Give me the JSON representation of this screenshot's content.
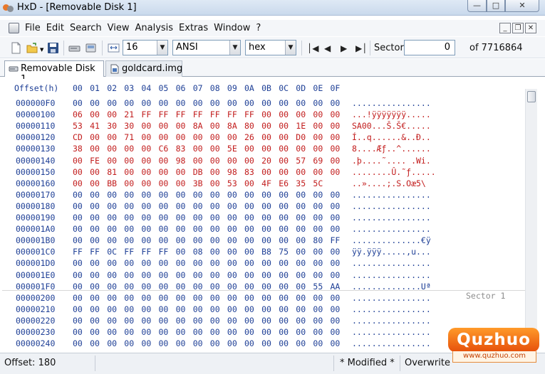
{
  "window": {
    "title": "HxD - [Removable Disk 1]"
  },
  "menu": {
    "items": [
      "File",
      "Edit",
      "Search",
      "View",
      "Analysis",
      "Extras",
      "Window",
      "?"
    ]
  },
  "toolbar": {
    "bytes_per_row": "16",
    "charset": "ANSI",
    "offset_base": "hex",
    "sector_label": "Sector",
    "sector_value": "0",
    "sector_total": "of 7716864"
  },
  "tabs": [
    {
      "label": "Removable Disk 1",
      "active": true
    },
    {
      "label": "goldcard.img",
      "active": false
    }
  ],
  "hex": {
    "header_offset": "Offset(h)",
    "header_cols": [
      "00",
      "01",
      "02",
      "03",
      "04",
      "05",
      "06",
      "07",
      "08",
      "09",
      "0A",
      "0B",
      "0C",
      "0D",
      "0E",
      "0F"
    ],
    "sector_marker": "Sector 1",
    "rows": [
      {
        "offset": "000000F0",
        "bytes": [
          "00",
          "00",
          "00",
          "00",
          "00",
          "00",
          "00",
          "00",
          "00",
          "00",
          "00",
          "00",
          "00",
          "00",
          "00",
          "00"
        ],
        "ascii": "................"
      },
      {
        "offset": "00000100",
        "bytes": [
          "06",
          "00",
          "00",
          "21",
          "FF",
          "FF",
          "FF",
          "FF",
          "FF",
          "FF",
          "FF",
          "00",
          "00",
          "00",
          "00",
          "00"
        ],
        "ascii": "...!ÿÿÿÿÿÿÿ....."
      },
      {
        "offset": "00000110",
        "bytes": [
          "53",
          "41",
          "30",
          "30",
          "00",
          "00",
          "00",
          "8A",
          "00",
          "8A",
          "80",
          "00",
          "00",
          "1E",
          "00",
          "00"
        ],
        "ascii": "SA00...Š.Š€....."
      },
      {
        "offset": "00000120",
        "bytes": [
          "CD",
          "00",
          "00",
          "71",
          "00",
          "00",
          "00",
          "00",
          "00",
          "00",
          "26",
          "00",
          "00",
          "D0",
          "00",
          "00"
        ],
        "ascii": "Í..q......&..Ð.."
      },
      {
        "offset": "00000130",
        "bytes": [
          "38",
          "00",
          "00",
          "00",
          "00",
          "C6",
          "83",
          "00",
          "00",
          "5E",
          "00",
          "00",
          "00",
          "00",
          "00",
          "00"
        ],
        "ascii": "8....Æƒ..^......"
      },
      {
        "offset": "00000140",
        "bytes": [
          "00",
          "FE",
          "00",
          "00",
          "00",
          "00",
          "98",
          "00",
          "00",
          "00",
          "00",
          "20",
          "00",
          "57",
          "69",
          "00"
        ],
        "ascii": ".þ....˜.... .Wi."
      },
      {
        "offset": "00000150",
        "bytes": [
          "00",
          "00",
          "81",
          "00",
          "00",
          "00",
          "00",
          "DB",
          "00",
          "98",
          "83",
          "00",
          "00",
          "00",
          "00",
          "00"
        ],
        "ascii": "........Û.˜ƒ....."
      },
      {
        "offset": "00000160",
        "bytes": [
          "00",
          "00",
          "BB",
          "00",
          "00",
          "00",
          "00",
          "3B",
          "00",
          "53",
          "00",
          "4F",
          "E6",
          "35",
          "5C",
          ""
        ],
        "ascii": "..»....;.S.Oæ5\\"
      },
      {
        "offset": "00000170",
        "bytes": [
          "00",
          "00",
          "00",
          "00",
          "00",
          "00",
          "00",
          "00",
          "00",
          "00",
          "00",
          "00",
          "00",
          "00",
          "00",
          "00"
        ],
        "ascii": "................"
      },
      {
        "offset": "00000180",
        "bytes": [
          "00",
          "00",
          "00",
          "00",
          "00",
          "00",
          "00",
          "00",
          "00",
          "00",
          "00",
          "00",
          "00",
          "00",
          "00",
          "00"
        ],
        "ascii": "................"
      },
      {
        "offset": "00000190",
        "bytes": [
          "00",
          "00",
          "00",
          "00",
          "00",
          "00",
          "00",
          "00",
          "00",
          "00",
          "00",
          "00",
          "00",
          "00",
          "00",
          "00"
        ],
        "ascii": "................"
      },
      {
        "offset": "000001A0",
        "bytes": [
          "00",
          "00",
          "00",
          "00",
          "00",
          "00",
          "00",
          "00",
          "00",
          "00",
          "00",
          "00",
          "00",
          "00",
          "00",
          "00"
        ],
        "ascii": "................"
      },
      {
        "offset": "000001B0",
        "bytes": [
          "00",
          "00",
          "00",
          "00",
          "00",
          "00",
          "00",
          "00",
          "00",
          "00",
          "00",
          "00",
          "00",
          "00",
          "80",
          "FF"
        ],
        "ascii": "..............€ÿ"
      },
      {
        "offset": "000001C0",
        "bytes": [
          "FF",
          "FF",
          "0C",
          "FF",
          "FF",
          "FF",
          "00",
          "08",
          "00",
          "00",
          "00",
          "B8",
          "75",
          "00",
          "00",
          "00"
        ],
        "ascii": "ÿÿ.ÿÿÿ.....,u..."
      },
      {
        "offset": "000001D0",
        "bytes": [
          "00",
          "00",
          "00",
          "00",
          "00",
          "00",
          "00",
          "00",
          "00",
          "00",
          "00",
          "00",
          "00",
          "00",
          "00",
          "00"
        ],
        "ascii": "................"
      },
      {
        "offset": "000001E0",
        "bytes": [
          "00",
          "00",
          "00",
          "00",
          "00",
          "00",
          "00",
          "00",
          "00",
          "00",
          "00",
          "00",
          "00",
          "00",
          "00",
          "00"
        ],
        "ascii": "................"
      },
      {
        "offset": "000001F0",
        "bytes": [
          "00",
          "00",
          "00",
          "00",
          "00",
          "00",
          "00",
          "00",
          "00",
          "00",
          "00",
          "00",
          "00",
          "00",
          "55",
          "AA"
        ],
        "ascii": "..............Uª"
      },
      {
        "offset": "00000200",
        "bytes": [
          "00",
          "00",
          "00",
          "00",
          "00",
          "00",
          "00",
          "00",
          "00",
          "00",
          "00",
          "00",
          "00",
          "00",
          "00",
          "00"
        ],
        "ascii": "................"
      },
      {
        "offset": "00000210",
        "bytes": [
          "00",
          "00",
          "00",
          "00",
          "00",
          "00",
          "00",
          "00",
          "00",
          "00",
          "00",
          "00",
          "00",
          "00",
          "00",
          "00"
        ],
        "ascii": "................"
      },
      {
        "offset": "00000220",
        "bytes": [
          "00",
          "00",
          "00",
          "00",
          "00",
          "00",
          "00",
          "00",
          "00",
          "00",
          "00",
          "00",
          "00",
          "00",
          "00",
          "00"
        ],
        "ascii": "................"
      },
      {
        "offset": "00000230",
        "bytes": [
          "00",
          "00",
          "00",
          "00",
          "00",
          "00",
          "00",
          "00",
          "00",
          "00",
          "00",
          "00",
          "00",
          "00",
          "00",
          "00"
        ],
        "ascii": "................"
      },
      {
        "offset": "00000240",
        "bytes": [
          "00",
          "00",
          "00",
          "00",
          "00",
          "00",
          "00",
          "00",
          "00",
          "00",
          "00",
          "00",
          "00",
          "00",
          "00",
          "00"
        ],
        "ascii": "................"
      }
    ]
  },
  "status": {
    "offset": "Offset: 180",
    "modified": "* Modified *",
    "mode": "Overwrite"
  },
  "watermark": {
    "brand": "Quzhuo",
    "url": "www.quzhuo.com"
  },
  "colors": {
    "modified": "#c21c1c",
    "offsets": "#1e3f96"
  }
}
